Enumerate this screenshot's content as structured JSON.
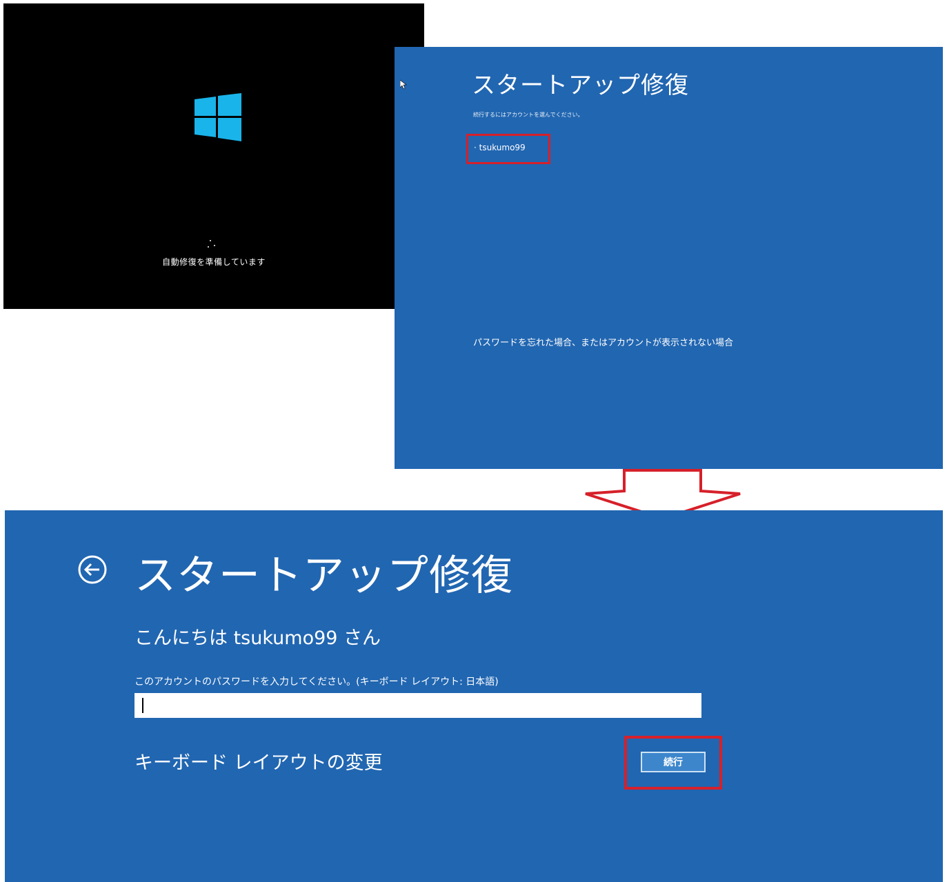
{
  "boot_screen": {
    "status_text": "自動修復を準備しています",
    "logo_icon": "windows-logo-icon",
    "logo_color": "#19b4ea"
  },
  "account_select": {
    "title": "スタートアップ修復",
    "subtitle": "続行するにはアカウントを選んでください。",
    "account_name": "tsukumo99",
    "forgot_link": "パスワードを忘れた場合、またはアカウントが表示されない場合"
  },
  "password_screen": {
    "back_icon": "back-arrow-icon",
    "title": "スタートアップ修復",
    "greeting": "こんにちは tsukumo99 さん",
    "prompt": "このアカウントのパスワードを入力してください。(キーボード レイアウト: 日本語)",
    "password_value": "",
    "change_keyboard_link": "キーボード レイアウトの変更",
    "continue_button": "続行"
  },
  "colors": {
    "background_blue": "#2166b1",
    "highlight_red": "#d6202a"
  }
}
